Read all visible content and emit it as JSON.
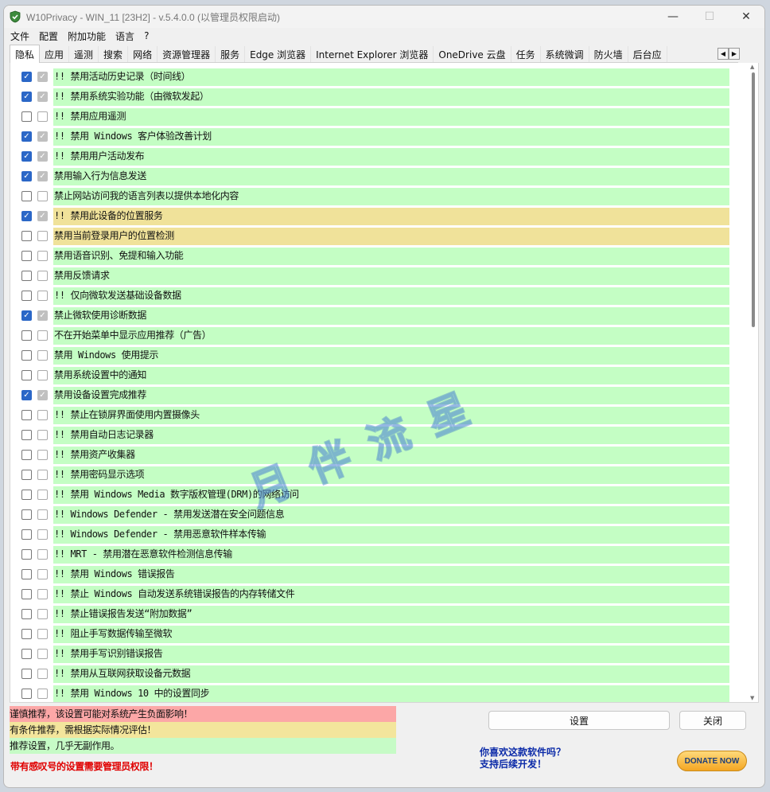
{
  "window": {
    "title": "W10Privacy - WIN_11 [23H2]  - v.5.4.0.0 (以管理员权限启动)",
    "controls": {
      "minimize": "—",
      "maximize": "☐",
      "close": "✕"
    }
  },
  "menu": [
    "文件",
    "配置",
    "附加功能",
    "语言",
    "?"
  ],
  "tabs": [
    "隐私",
    "应用",
    "遥测",
    "搜索",
    "网络",
    "资源管理器",
    "服务",
    "Edge 浏览器",
    "Internet Explorer 浏览器",
    "OneDrive 云盘",
    "任务",
    "系统微调",
    "防火墙",
    "后台应"
  ],
  "active_tab": 0,
  "tab_scroll": {
    "left": "◀",
    "right": "▶"
  },
  "rows": [
    {
      "checked": true,
      "label": "!! 禁用活动历史记录（时间线）",
      "level": "green"
    },
    {
      "checked": true,
      "label": "!! 禁用系统实验功能（由微软发起）",
      "level": "green"
    },
    {
      "checked": false,
      "label": "!! 禁用应用遥测",
      "level": "green"
    },
    {
      "checked": true,
      "label": "!! 禁用 Windows 客户体验改善计划",
      "level": "green"
    },
    {
      "checked": true,
      "label": "!! 禁用用户活动发布",
      "level": "green"
    },
    {
      "checked": true,
      "label": "禁用输入行为信息发送",
      "level": "green"
    },
    {
      "checked": false,
      "label": "禁止网站访问我的语言列表以提供本地化内容",
      "level": "green"
    },
    {
      "checked": true,
      "label": "!! 禁用此设备的位置服务",
      "level": "yellow"
    },
    {
      "checked": false,
      "label": "禁用当前登录用户的位置检测",
      "level": "yellow"
    },
    {
      "checked": false,
      "label": "禁用语音识别、免提和输入功能",
      "level": "green"
    },
    {
      "checked": false,
      "label": "禁用反馈请求",
      "level": "green"
    },
    {
      "checked": false,
      "label": "!! 仅向微软发送基础设备数据",
      "level": "green"
    },
    {
      "checked": true,
      "label": "禁止微软使用诊断数据",
      "level": "green"
    },
    {
      "checked": false,
      "label": "不在开始菜单中显示应用推荐（广告）",
      "level": "green"
    },
    {
      "checked": false,
      "label": "禁用 Windows 使用提示",
      "level": "green"
    },
    {
      "checked": false,
      "label": "禁用系统设置中的通知",
      "level": "green"
    },
    {
      "checked": true,
      "label": "禁用设备设置完成推荐",
      "level": "green"
    },
    {
      "checked": false,
      "label": "!! 禁止在锁屏界面使用内置摄像头",
      "level": "green"
    },
    {
      "checked": false,
      "label": "!! 禁用自动日志记录器",
      "level": "green"
    },
    {
      "checked": false,
      "label": "!! 禁用资产收集器",
      "level": "green"
    },
    {
      "checked": false,
      "label": "!! 禁用密码显示选项",
      "level": "green"
    },
    {
      "checked": false,
      "label": "!! 禁用 Windows Media 数字版权管理(DRM)的网络访问",
      "level": "green"
    },
    {
      "checked": false,
      "label": "!! Windows Defender - 禁用发送潜在安全问题信息",
      "level": "green"
    },
    {
      "checked": false,
      "label": "!! Windows Defender - 禁用恶意软件样本传输",
      "level": "green"
    },
    {
      "checked": false,
      "label": "!! MRT - 禁用潜在恶意软件检测信息传输",
      "level": "green"
    },
    {
      "checked": false,
      "label": "!! 禁用 Windows 错误报告",
      "level": "green"
    },
    {
      "checked": false,
      "label": "!! 禁止 Windows 自动发送系统错误报告的内存转储文件",
      "level": "green"
    },
    {
      "checked": false,
      "label": "!! 禁止错误报告发送“附加数据”",
      "level": "green"
    },
    {
      "checked": false,
      "label": "!! 阻止手写数据传输至微软",
      "level": "green"
    },
    {
      "checked": false,
      "label": "!! 禁用手写识别错误报告",
      "level": "green"
    },
    {
      "checked": false,
      "label": "!! 禁用从互联网获取设备元数据",
      "level": "green"
    },
    {
      "checked": false,
      "label": "!! 禁用 Windows 10 中的设置同步",
      "level": "green"
    }
  ],
  "watermark": "月伴流星",
  "legend": {
    "red": "谨慎推荐，该设置可能对系统产生负面影响！",
    "yellow": "有条件推荐，需根据实际情况评估！",
    "green": "推荐设置，几乎无副作用。"
  },
  "admin_note": "带有感叹号的设置需要管理员权限！",
  "buttons": {
    "settings": "设置",
    "close": "关闭"
  },
  "promo": {
    "line1": "你喜欢这款软件吗？",
    "line2": "支持后续开发！"
  },
  "donate_label": "DONATE NOW",
  "colors": {
    "green": "#c4fec4",
    "yellow": "#f0e29a",
    "red": "#fca7a7",
    "checkbox_blue": "#2b67c7"
  }
}
